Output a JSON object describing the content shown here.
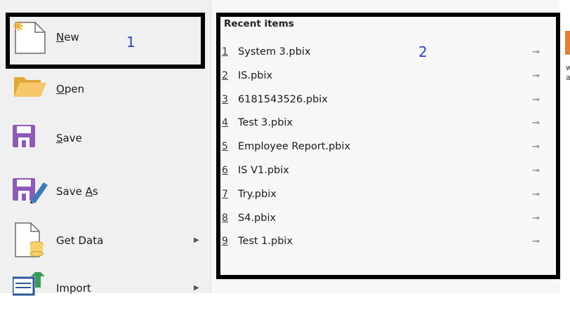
{
  "menu": {
    "items": [
      {
        "label": "New",
        "mnemonic": "N",
        "rest": "ew",
        "icon": "new-document-icon",
        "submenu": false
      },
      {
        "label": "Open",
        "mnemonic": "O",
        "rest": "pen",
        "icon": "open-folder-icon",
        "submenu": false
      },
      {
        "label": "Save",
        "mnemonic": "S",
        "rest": "ave",
        "icon": "save-icon",
        "submenu": false
      },
      {
        "label": "Save As",
        "prefix": "Save ",
        "mnemonic": "A",
        "rest": "s",
        "icon": "save-as-icon",
        "submenu": false
      },
      {
        "label": "Get Data",
        "icon": "get-data-icon",
        "submenu": true
      },
      {
        "label": "Import",
        "icon": "import-icon",
        "submenu": true
      }
    ]
  },
  "recent": {
    "header": "Recent items",
    "items": [
      {
        "num": "1",
        "name": "System 3.pbix"
      },
      {
        "num": "2",
        "name": "IS.pbix"
      },
      {
        "num": "3",
        "name": "6181543526.pbix"
      },
      {
        "num": "4",
        "name": "Test 3.pbix"
      },
      {
        "num": "5",
        "name": "Employee Report.pbix"
      },
      {
        "num": "6",
        "name": "IS V1.pbix"
      },
      {
        "num": "7",
        "name": "Try.pbix"
      },
      {
        "num": "8",
        "name": "S4.pbix"
      },
      {
        "num": "9",
        "name": "Test 1.pbix"
      }
    ],
    "pin_glyph": "⊸"
  },
  "annotations": {
    "box1": "1",
    "box2": "2"
  },
  "sliver": {
    "t1": "w",
    "t2": "a"
  },
  "colors": {
    "accent": "#2b579a",
    "annotation": "#2f3fd0",
    "orange": "#e87e2e"
  }
}
